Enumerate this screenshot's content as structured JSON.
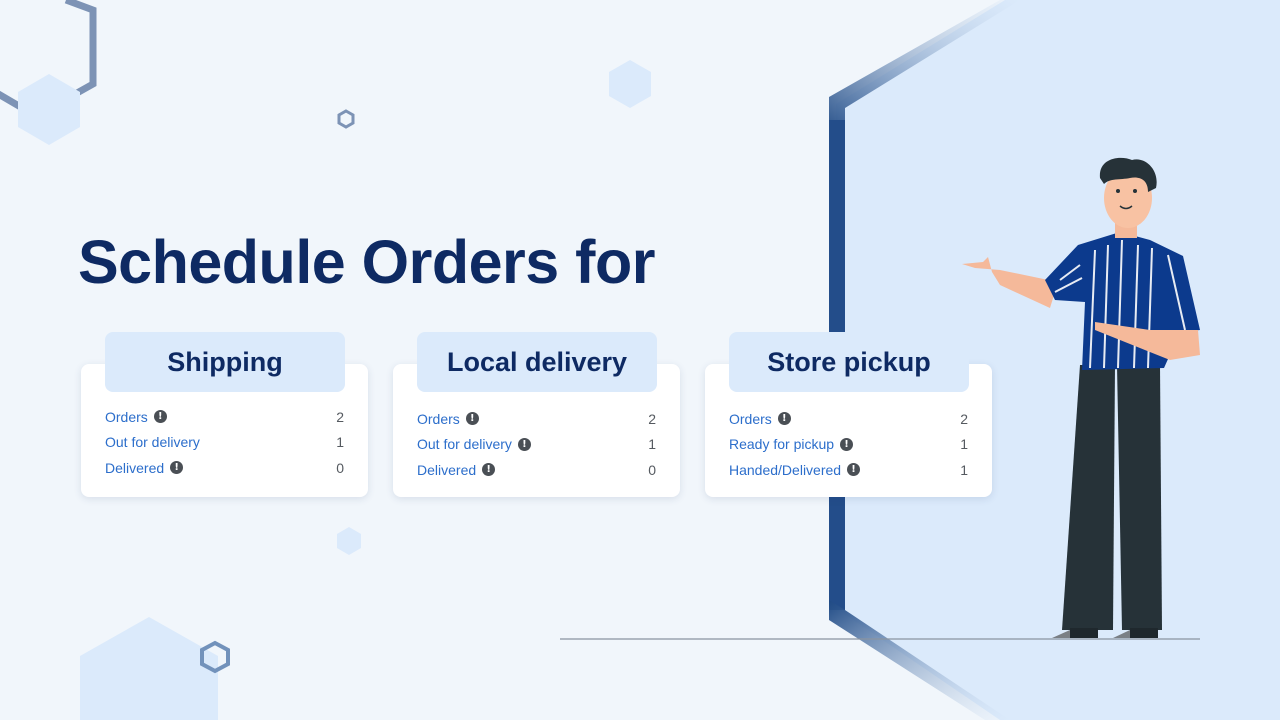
{
  "headline": "Schedule Orders for",
  "colors": {
    "background": "#f1f6fb",
    "panel": "#dbeafb",
    "title": "#0e2a63",
    "link": "#2c6ecb",
    "accent_frame": "#1f4a85"
  },
  "cards": [
    {
      "title": "Shipping",
      "rows": [
        {
          "label": "Orders",
          "info": true,
          "value": "2"
        },
        {
          "label": "Out for delivery",
          "info": false,
          "value": "1"
        },
        {
          "label": "Delivered",
          "info": true,
          "value": "0"
        }
      ]
    },
    {
      "title": "Local delivery",
      "rows": [
        {
          "label": "Orders",
          "info": true,
          "value": "2"
        },
        {
          "label": "Out for delivery",
          "info": true,
          "value": "1"
        },
        {
          "label": "Delivered",
          "info": true,
          "value": "0"
        }
      ]
    },
    {
      "title": "Store pickup",
      "rows": [
        {
          "label": "Orders",
          "info": true,
          "value": "2"
        },
        {
          "label": "Ready for pickup",
          "info": true,
          "value": "1"
        },
        {
          "label": "Handed/Delivered",
          "info": true,
          "value": "1"
        }
      ]
    }
  ],
  "icons": {
    "info": "!"
  },
  "illustration": "person-pointing"
}
